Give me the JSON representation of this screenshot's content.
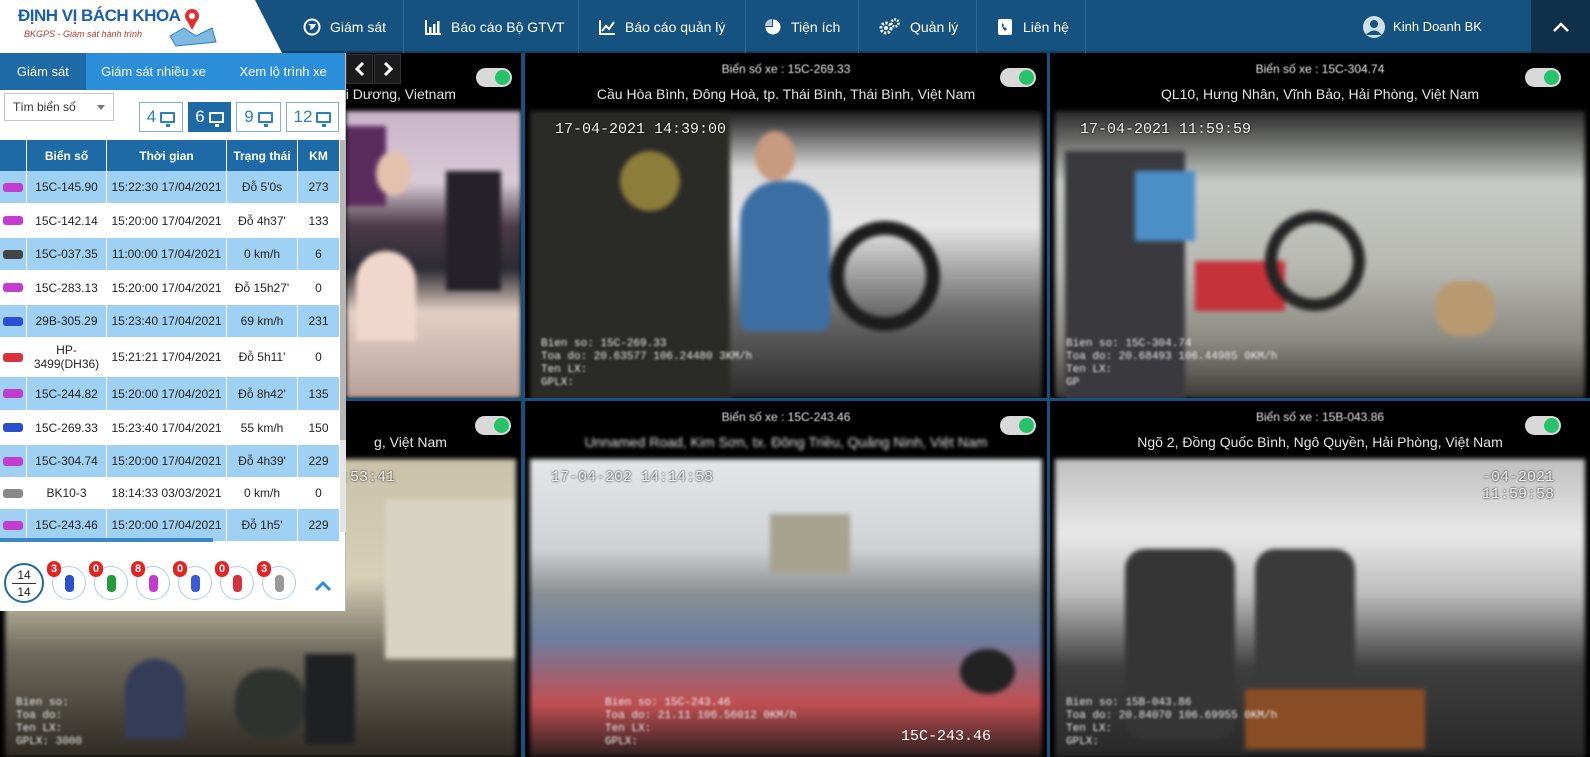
{
  "logo": {
    "brand": "ĐỊNH VỊ BÁCH KHOA",
    "tagline": "BKGPS - Giám sát hành trình"
  },
  "nav": [
    {
      "label": "Giám sát",
      "icon": "globe-icon"
    },
    {
      "label": "Báo cáo Bộ GTVT",
      "icon": "bar-chart-icon"
    },
    {
      "label": "Báo cáo quản lý",
      "icon": "line-chart-icon"
    },
    {
      "label": "Tiện ích",
      "icon": "pie-chart-icon"
    },
    {
      "label": "Quản lý",
      "icon": "gears-icon"
    },
    {
      "label": "Liên hệ",
      "icon": "phone-book-icon"
    }
  ],
  "user": {
    "name": "Kinh Doanh BK"
  },
  "colors": {
    "topbar": "#16527f",
    "accent": "#1d6aa6",
    "tab": "#2b8ed8",
    "row_highlight": "#9fd1f4",
    "toggle_on": "#27c36a",
    "badge": "#e52323"
  },
  "panel": {
    "tabs": [
      "Giám sát",
      "Giám sát nhiều xe",
      "Xem lộ trình xe"
    ],
    "search_placeholder": "Tìm biển số",
    "grid_options": [
      "4",
      "6",
      "9",
      "12"
    ],
    "grid_selected": "6",
    "table": {
      "headers": [
        "",
        "Biển số",
        "Thời gian",
        "Trạng thái",
        "KM"
      ],
      "rows": [
        {
          "icon": "truck-icon",
          "color": "#c43bd1",
          "plate": "15C-145.90",
          "time": "15:22:30 17/04/2021",
          "status": "Đỗ 5'0s",
          "km": "273"
        },
        {
          "icon": "truck-icon",
          "color": "#c43bd1",
          "plate": "15C-142.14",
          "time": "15:20:00 17/04/2021",
          "status": "Đỗ 4h37'",
          "km": "133"
        },
        {
          "icon": "car-icon",
          "color": "#444444",
          "plate": "15C-037.35",
          "time": "11:00:00 17/04/2021",
          "status": "0 km/h",
          "km": "6"
        },
        {
          "icon": "car-icon",
          "color": "#c43bd1",
          "plate": "15C-283.13",
          "time": "15:20:00 17/04/2021",
          "status": "Đỗ 15h27'",
          "km": "0"
        },
        {
          "icon": "bus-icon",
          "color": "#2a4fd0",
          "plate": "29B-305.29",
          "time": "15:23:40 17/04/2021",
          "status": "69 km/h",
          "km": "231"
        },
        {
          "icon": "boat-icon",
          "color": "#d9313b",
          "plate": "HP-3499(DH36)",
          "time": "15:21:21 17/04/2021",
          "status": "Đỗ 5h11'",
          "km": "0"
        },
        {
          "icon": "car-icon",
          "color": "#c43bd1",
          "plate": "15C-244.82",
          "time": "15:20:00 17/04/2021",
          "status": "Đỗ 8h42'",
          "km": "135"
        },
        {
          "icon": "truck-icon",
          "color": "#2a4fd0",
          "plate": "15C-269.33",
          "time": "15:23:40 17/04/2021",
          "status": "55 km/h",
          "km": "150"
        },
        {
          "icon": "truck-icon",
          "color": "#c43bd1",
          "plate": "15C-304.74",
          "time": "15:20:00 17/04/2021",
          "status": "Đỗ 4h39'",
          "km": "229"
        },
        {
          "icon": "bus-icon",
          "color": "#8a8a8a",
          "plate": "BK10-3",
          "time": "18:14:33 03/03/2021",
          "status": "0 km/h",
          "km": "0"
        },
        {
          "icon": "truck-icon",
          "color": "#c43bd1",
          "plate": "15C-243.46",
          "time": "15:20:00 17/04/2021",
          "status": "Đỗ 1h5'",
          "km": "229"
        }
      ]
    },
    "summary": {
      "total_top": "14",
      "total_bottom": "14",
      "counts": [
        {
          "value": "3",
          "color": "#2a4fd0"
        },
        {
          "value": "0",
          "color": "#1f9d3a"
        },
        {
          "value": "8",
          "color": "#c43bd1"
        },
        {
          "value": "0",
          "color": "#3a5bd8"
        },
        {
          "value": "0",
          "color": "#d9313b"
        },
        {
          "value": "3",
          "color": "#9a9a9a"
        }
      ]
    }
  },
  "cameras": [
    {
      "plate": "",
      "address": "ải Dương, Vietnam",
      "timestamp": "",
      "overlay": []
    },
    {
      "plate": "Biển số xe : 15C-269.33",
      "address": "Cầu Hòa Bình, Đông Hoà, tp. Thái Bình, Thái Bình, Việt Nam",
      "timestamp": "17-04-2021 14:39:00",
      "overlay": [
        "Bien so: 15C-269.33",
        "Toa do: 20.63577 106.24480 3KM/h",
        "Ten LX:",
        "GPLX:"
      ]
    },
    {
      "plate": "Biển số xe : 15C-304.74",
      "address": "QL10, Hưng Nhân, Vĩnh Bảo, Hải Phòng, Việt Nam",
      "timestamp": "17-04-2021 11:59:59",
      "overlay": [
        "Bien so: 15C-304.74",
        "Toa do: 20.68493 106.44985 0KM/h",
        "Ten LX:",
        "GP"
      ]
    },
    {
      "plate": "",
      "address": "g, Việt Nam",
      "timestamp": "-03-2021 16:53:41",
      "overlay": [
        "Bien so: ",
        "Toa do: ",
        "Ten LX: ",
        "GPLX: 3000"
      ]
    },
    {
      "plate": "Biển số xe : 15C-243.46",
      "address": "Unnamed Road, Kim Sơn, tx. Đông Triều, Quảng Ninh, Việt Nam",
      "timestamp": "17-04-202 14:14:58",
      "overlay": [
        "Bien so: 15C-243.46",
        "Toa do: 21.11 106.56012 0KM/h",
        "Ten LX: ",
        "GPLX: "
      ],
      "plate_stamp": "15C-243.46"
    },
    {
      "plate": "Biển số xe : 15B-043.86",
      "address": "Ngõ 2, Đồng Quốc Bình, Ngô Quyền, Hải Phòng, Việt Nam",
      "timestamp": "-04-2021 11:59:58",
      "overlay": [
        "Bien so: 15B-043.86",
        "Toa do: 20.84070 106.69955 0KM/h",
        "Ten LX:",
        "GPLX:"
      ]
    }
  ]
}
